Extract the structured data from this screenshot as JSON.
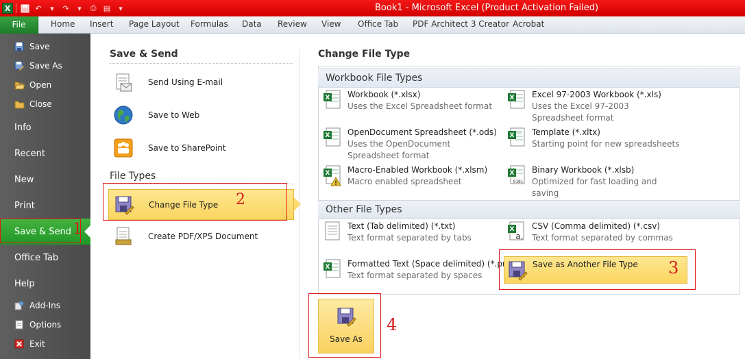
{
  "window": {
    "title": "Book1 - Microsoft Excel (Product Activation Failed)"
  },
  "ribbon_tabs": [
    "File",
    "Home",
    "Insert",
    "Page Layout",
    "Formulas",
    "Data",
    "Review",
    "View",
    "Office Tab",
    "PDF Architect 3 Creator",
    "Acrobat"
  ],
  "nav": {
    "save": "Save",
    "save_as": "Save As",
    "open": "Open",
    "close": "Close",
    "info": "Info",
    "recent": "Recent",
    "new": "New",
    "print": "Print",
    "save_send": "Save & Send",
    "office_tab": "Office Tab",
    "help": "Help",
    "add_ins": "Add-Ins",
    "options": "Options",
    "exit": "Exit"
  },
  "middle": {
    "save_send_heading": "Save & Send",
    "send_email": "Send Using E-mail",
    "save_web": "Save to Web",
    "save_sharepoint": "Save to SharePoint",
    "file_types_heading": "File Types",
    "change_file_type": "Change File Type",
    "create_pdf": "Create PDF/XPS Document"
  },
  "right": {
    "heading": "Change File Type",
    "workbook_heading": "Workbook File Types",
    "other_heading": "Other File Types",
    "workbook": [
      {
        "title": "Workbook (*.xlsx)",
        "desc": "Uses the Excel Spreadsheet format"
      },
      {
        "title": "Excel 97-2003 Workbook (*.xls)",
        "desc": "Uses the Excel 97-2003 Spreadsheet format"
      },
      {
        "title": "OpenDocument Spreadsheet (*.ods)",
        "desc": "Uses the OpenDocument Spreadsheet format"
      },
      {
        "title": "Template (*.xltx)",
        "desc": "Starting point for new spreadsheets"
      },
      {
        "title": "Macro-Enabled Workbook (*.xlsm)",
        "desc": "Macro enabled spreadsheet"
      },
      {
        "title": "Binary Workbook (*.xlsb)",
        "desc": "Optimized for fast loading and saving"
      }
    ],
    "other": [
      {
        "title": "Text (Tab delimited) (*.txt)",
        "desc": "Text format separated by tabs"
      },
      {
        "title": "CSV (Comma delimited) (*.csv)",
        "desc": "Text format separated by commas"
      },
      {
        "title": "Formatted Text (Space delimited) (*.prn)",
        "desc": "Text format separated by spaces"
      },
      {
        "title": "Save as Another File Type",
        "desc": ""
      }
    ],
    "save_as_button": "Save As"
  },
  "annotations": [
    "1",
    "2",
    "3",
    "4"
  ],
  "colors": {
    "title_bar": "#e00000",
    "file_tab": "#2a8c33",
    "nav_bg": "#555555",
    "nav_selected": "#2fa52e",
    "highlight": "#fbd560",
    "annotation_red": "#d21c1c"
  }
}
